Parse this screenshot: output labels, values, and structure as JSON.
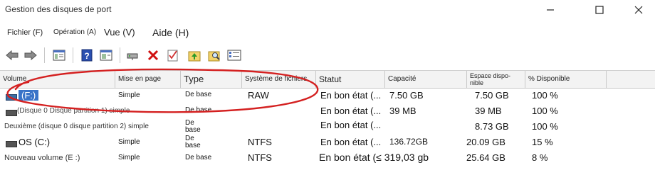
{
  "window": {
    "title": "Gestion des disques de port",
    "minimize_glyph": "—",
    "maximize_glyph": "☐",
    "close_glyph": "✕"
  },
  "menu": [
    {
      "label": "Fichier (F)"
    },
    {
      "label": "Opération (A)"
    },
    {
      "label": "Vue (V)"
    },
    {
      "label": "Aide (H)"
    }
  ],
  "toolbar": {
    "icons": [
      "back-icon",
      "forward-icon",
      "console-tree-icon",
      "help-icon",
      "properties-icon",
      "connect-drive-icon",
      "delete-icon",
      "check-icon",
      "up-folder-icon",
      "search-folder-icon",
      "list-view-icon"
    ]
  },
  "table": {
    "columns": [
      "Volume",
      "Mise en page",
      "Type",
      "Système de fichiers",
      "Statut",
      "Capacité",
      "Espace dispo-\nnible",
      "% Disponible"
    ],
    "rows": [
      {
        "volume": "(F:)",
        "layout": "Simple",
        "type": "De base",
        "fs": "RAW",
        "status": "En bon état (...",
        "capacity": "7.50 GB",
        "free": "7.50 GB",
        "pct": "100 %"
      },
      {
        "volume": "(Disque 0 Disque partition 1) simple",
        "layout": "",
        "type": "De base",
        "fs": "",
        "status": "En bon état (...",
        "capacity": "39 MB",
        "free": "39 MB",
        "pct": "100 %"
      },
      {
        "volume": "Deuxième (disque 0 disque partition 2) simple",
        "layout": "",
        "type": "De base",
        "fs": "",
        "status": "En bon état (...",
        "capacity": "",
        "free": "8.73 GB",
        "pct": "100 %"
      },
      {
        "volume": "OS (C:)",
        "layout": "Simple",
        "type": "De base",
        "fs": "NTFS",
        "status": "En bon état (...",
        "capacity": "136.72GB",
        "free": "20.09 GB",
        "pct": "15 %"
      },
      {
        "volume": "Nouveau volume (E :)",
        "layout": "Simple",
        "type": "De base",
        "fs": "NTFS",
        "status": "En bon état (≤ 319,03 gb",
        "capacity": "",
        "free": "25.64 GB",
        "pct": "8 %"
      }
    ]
  },
  "colors": {
    "highlight_oval": "#d42020",
    "header_bg": "#f3f3f3"
  }
}
